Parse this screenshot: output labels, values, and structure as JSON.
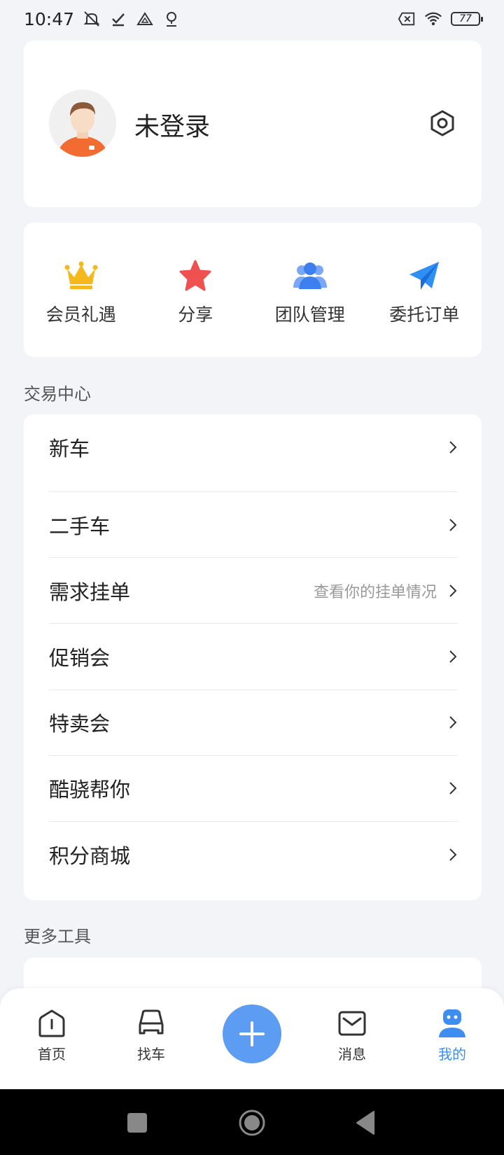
{
  "status_bar": {
    "time": "10:47",
    "battery": "77",
    "icons": [
      "mute-icon",
      "check-icon",
      "drive-icon",
      "location-icon",
      "sim-off-icon",
      "wifi-icon",
      "battery-icon"
    ]
  },
  "profile": {
    "name": "未登录",
    "avatar": "avatar-icon",
    "settings_icon": "settings-hex-icon"
  },
  "quick_actions": [
    {
      "label": "会员礼遇",
      "icon": "crown-icon",
      "color": "#f5b91e"
    },
    {
      "label": "分享",
      "icon": "star-icon",
      "color": "#ef5050"
    },
    {
      "label": "团队管理",
      "icon": "team-icon",
      "color": "#4f8ff5"
    },
    {
      "label": "委托订单",
      "icon": "paper-plane-icon",
      "color": "#2f8ff2"
    }
  ],
  "sections": {
    "trade_center": "交易中心",
    "more_tools": "更多工具"
  },
  "menu_items": [
    {
      "label": "新车",
      "hint": ""
    },
    {
      "label": "二手车",
      "hint": ""
    },
    {
      "label": "需求挂单",
      "hint": "查看你的挂单情况"
    },
    {
      "label": "促销会",
      "hint": ""
    },
    {
      "label": "特卖会",
      "hint": ""
    },
    {
      "label": "酷骁帮你",
      "hint": ""
    },
    {
      "label": "积分商城",
      "hint": ""
    }
  ],
  "bottom_nav": {
    "items": [
      {
        "label": "首页",
        "icon": "home-icon"
      },
      {
        "label": "找车",
        "icon": "car-icon"
      },
      {
        "label": "消息",
        "icon": "mail-icon"
      },
      {
        "label": "我的",
        "icon": "profile-robot-icon"
      }
    ],
    "active": "我的",
    "add_icon": "plus-icon",
    "accent_color": "#3d8ef0"
  }
}
